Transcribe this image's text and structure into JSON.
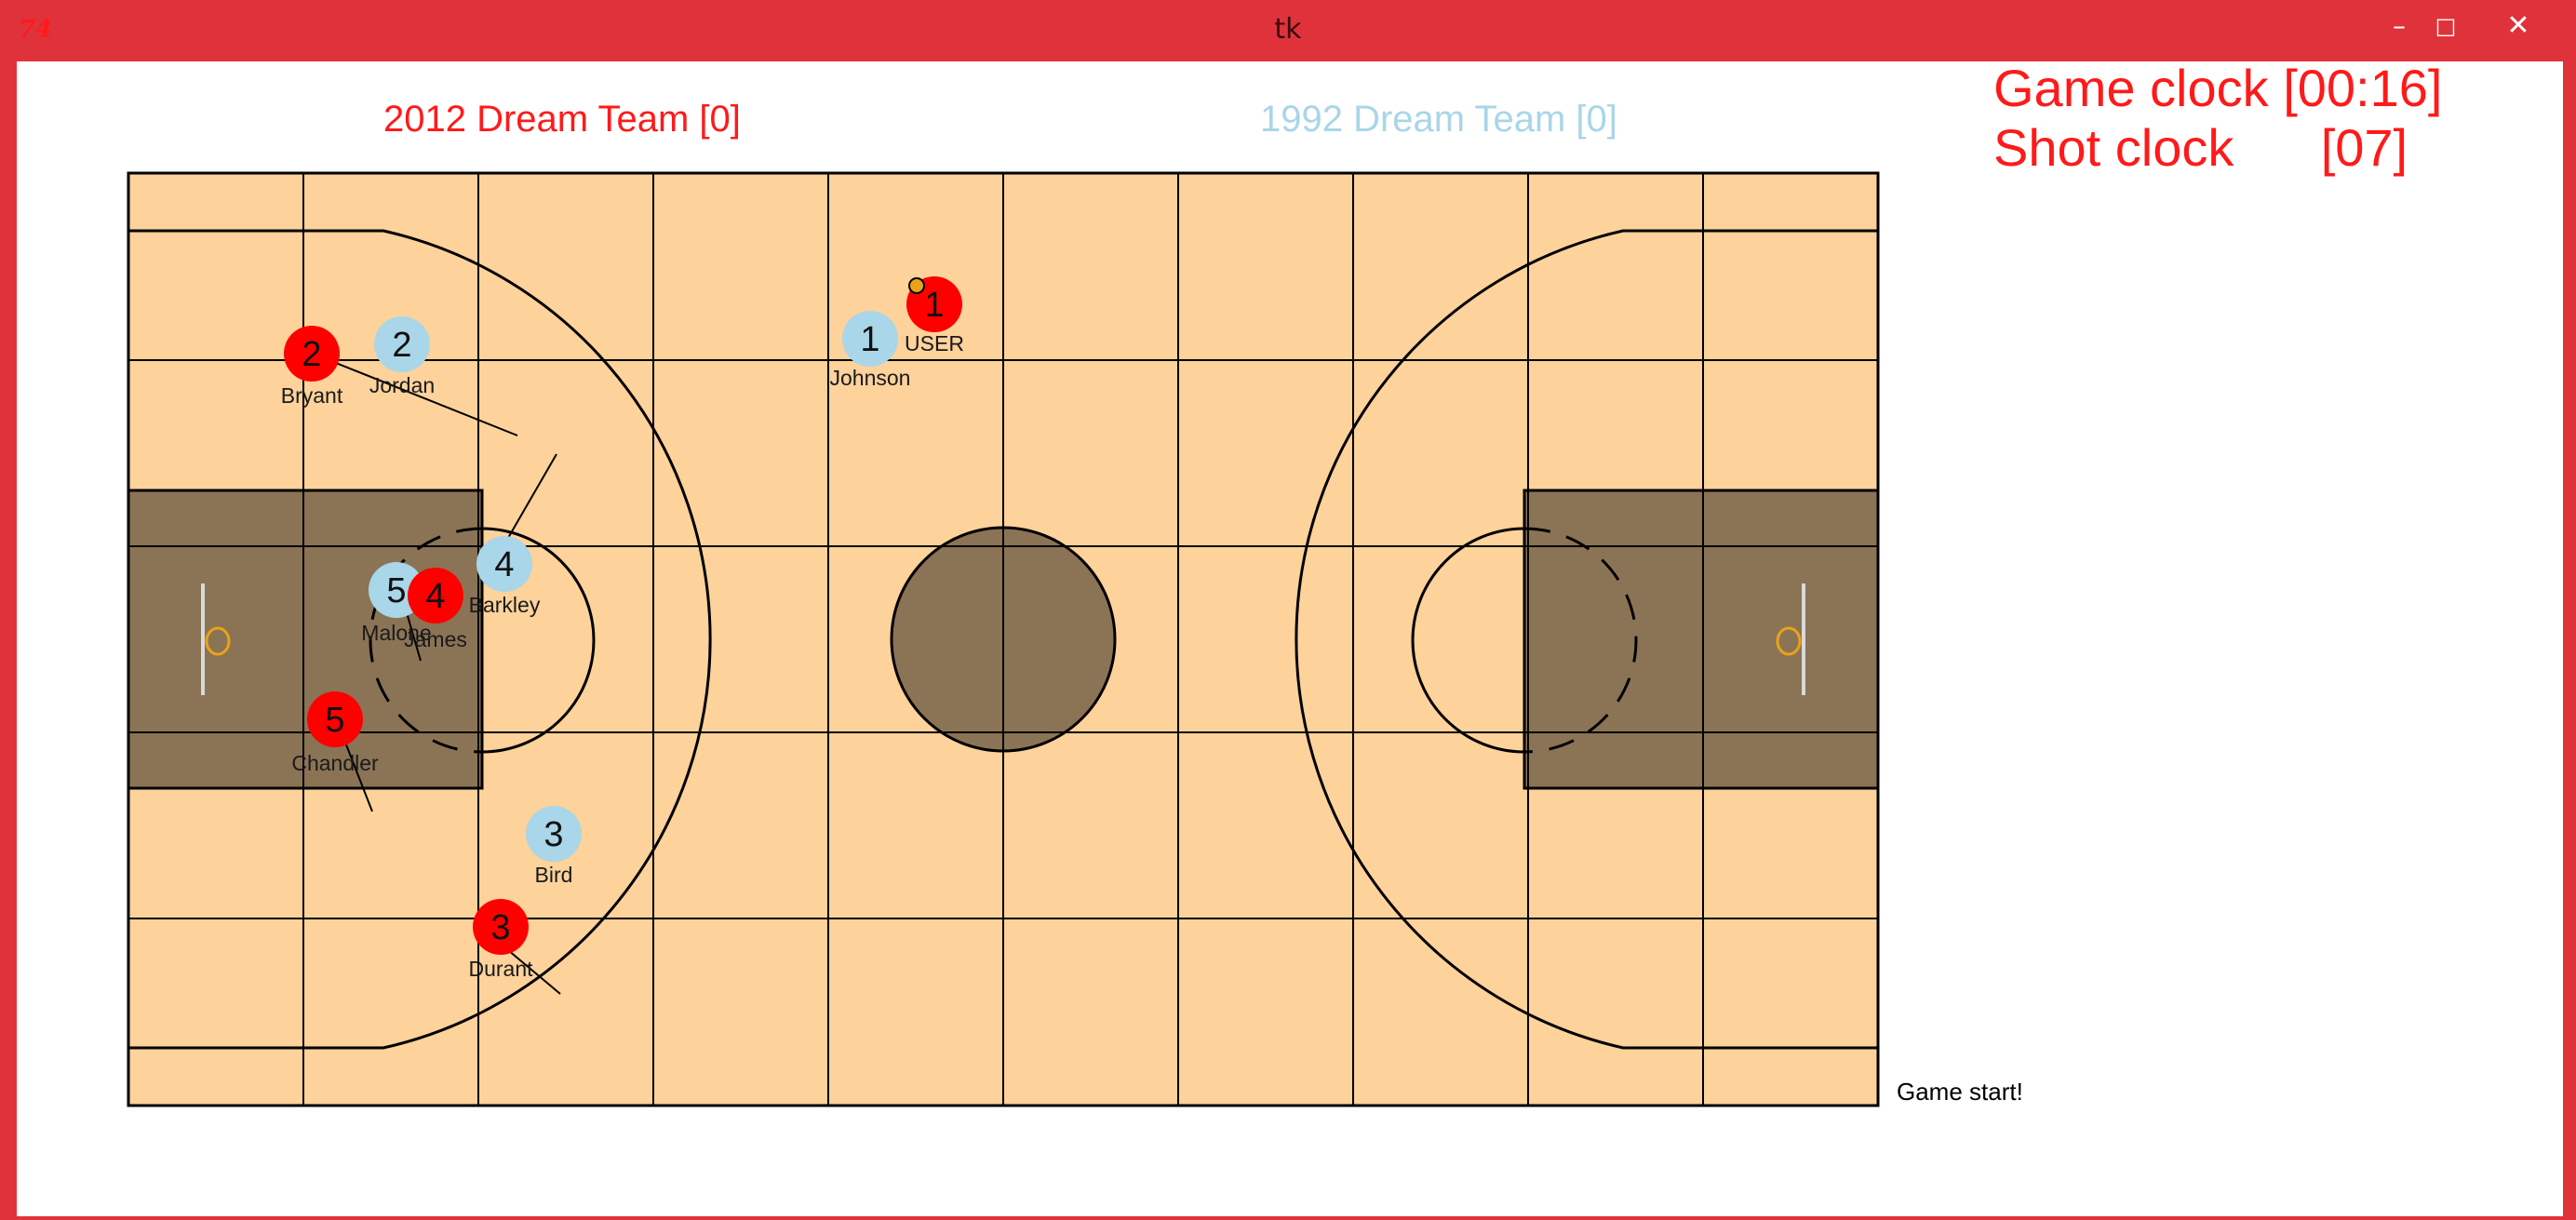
{
  "window": {
    "title": "tk",
    "icon_glyph": "74",
    "controls": {
      "minimize": "–",
      "maximize": "□",
      "close": "✕"
    }
  },
  "scoreboard": {
    "home_team": "2012 Dream Team [0]",
    "away_team": "1992 Dream Team [0]",
    "game_clock": "Game clock [00:16]",
    "shot_clock": "Shot clock      [07]"
  },
  "status": "Game start!",
  "colors": {
    "home_team": "#ff0000",
    "away_team": "#a9d6e8",
    "court": "#fdd29b",
    "paint": "#8b7355",
    "rim": "#e8a317"
  },
  "players": [
    {
      "team": "home",
      "number": "1",
      "name": "USER"
    },
    {
      "team": "home",
      "number": "2",
      "name": "Bryant"
    },
    {
      "team": "home",
      "number": "3",
      "name": "Durant"
    },
    {
      "team": "home",
      "number": "4",
      "name": "James"
    },
    {
      "team": "home",
      "number": "5",
      "name": "Chandler"
    },
    {
      "team": "away",
      "number": "1",
      "name": "Johnson"
    },
    {
      "team": "away",
      "number": "2",
      "name": "Jordan"
    },
    {
      "team": "away",
      "number": "3",
      "name": "Bird"
    },
    {
      "team": "away",
      "number": "4",
      "name": "Barkley"
    },
    {
      "team": "away",
      "number": "5",
      "name": "Malone"
    }
  ]
}
